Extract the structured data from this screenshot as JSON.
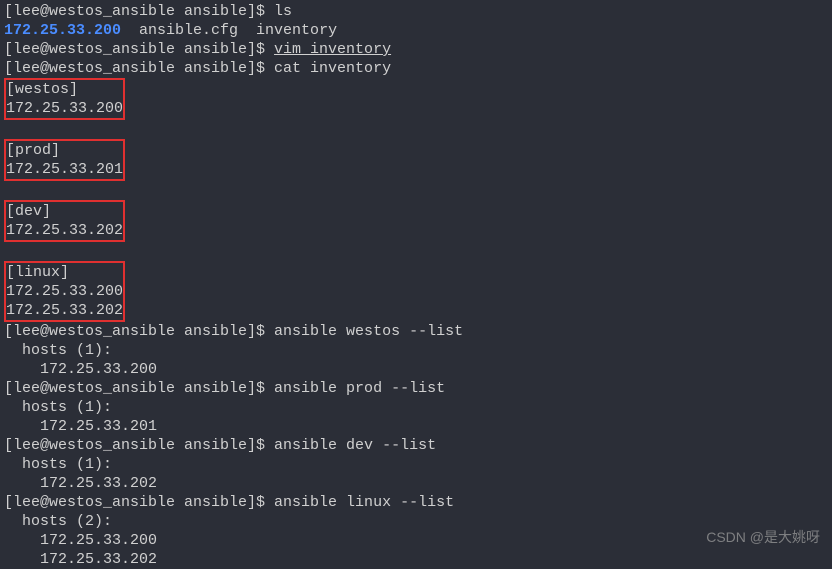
{
  "prompt": "[lee@westos_ansible ansible]$ ",
  "commands": {
    "ls": "ls",
    "vim": "vim inventory",
    "cat": "cat inventory",
    "ans_westos": "ansible westos --list",
    "ans_prod": "ansible prod --list",
    "ans_dev": "ansible dev --list",
    "ans_linux": "ansible linux --list"
  },
  "ls_output": {
    "dir": "172.25.33.200",
    "files_rest": "  ansible.cfg  inventory"
  },
  "inventory": {
    "westos_group": "[westos]\n172.25.33.200",
    "prod_group": "[prod]\n172.25.33.201",
    "dev_group": "[dev]\n172.25.33.202",
    "linux_group": "[linux]\n172.25.33.200\n172.25.33.202"
  },
  "output": {
    "hosts1": "  hosts (1):",
    "hosts2": "  hosts (2):",
    "ip200": "    172.25.33.200",
    "ip201": "    172.25.33.201",
    "ip202": "    172.25.33.202"
  },
  "watermark": "CSDN @是大姚呀"
}
